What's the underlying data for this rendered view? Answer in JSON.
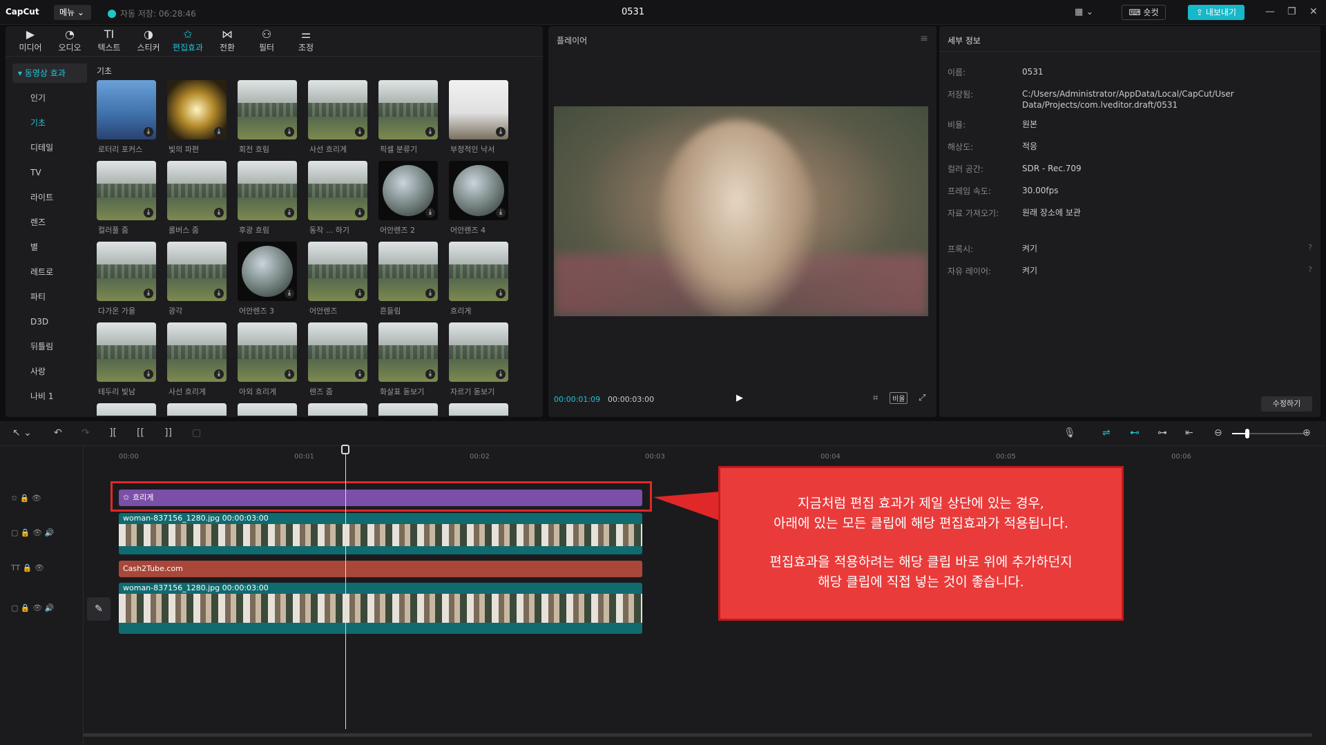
{
  "titlebar": {
    "logo": "CapCut",
    "menu_label": "메뉴 ⌄",
    "autosave": "자동 저장: 06:28:46",
    "doc_title": "0531",
    "layout_label": "▦ ⌄",
    "shortcut_label": "⌨ 숏컷",
    "export_label": "⇪ 내보내기",
    "win_min": "—",
    "win_max": "❐",
    "win_close": "✕"
  },
  "media": {
    "tabs": [
      {
        "icon": "▶",
        "label": "미디어"
      },
      {
        "icon": "◔",
        "label": "오디오"
      },
      {
        "icon": "TI",
        "label": "텍스트"
      },
      {
        "icon": "◑",
        "label": "스티커"
      },
      {
        "icon": "✩",
        "label": "편집효과"
      },
      {
        "icon": "⋈",
        "label": "전환"
      },
      {
        "icon": "⚇",
        "label": "필터"
      },
      {
        "icon": "⚌",
        "label": "조정"
      }
    ],
    "category_head": "▾ 동영상 효과",
    "categories": [
      "인기",
      "기초",
      "디테일",
      "TV",
      "라이트",
      "렌즈",
      "별",
      "레트로",
      "파티",
      "D3D",
      "뒤틀림",
      "사랑",
      "나비 1"
    ],
    "grid_label": "기초",
    "download_icon": "⤓",
    "effects": [
      "로터리 포커스",
      "빛의 파편",
      "회전 흐림",
      "사선 흐리게",
      "픽셀 분류기",
      "부정적인 낙서",
      "컬러풀 줌",
      "롤버스 줌",
      "후광 흐림",
      "동작 ... 하기",
      "어안렌즈 2",
      "어안렌즈 4",
      "다가온 가을",
      "광각",
      "어안렌즈 3",
      "어안렌즈",
      "흔들림",
      "흐리게",
      "테두리 빛남",
      "사선 흐리게",
      "아외 흐리게",
      "렌즈 줌",
      "화살표 돋보기",
      "자르기 돋보기"
    ]
  },
  "player": {
    "title": "플레이어",
    "menu_icon": "≡",
    "time_current": "00:00:01:09",
    "time_total": "00:00:03:00",
    "play_icon": "▶",
    "ratio_label": "비율",
    "screenshot_icon": "⌗",
    "fullscreen_icon": "⤢"
  },
  "details": {
    "title": "세부 정보",
    "rows": [
      {
        "k": "이름:",
        "v": "0531"
      },
      {
        "k": "저장됨:",
        "v": "C:/Users/Administrator/AppData/Local/CapCut/User Data/Projects/com.lveditor.draft/0531"
      },
      {
        "k": "비율:",
        "v": "원본"
      },
      {
        "k": "해상도:",
        "v": "적응"
      },
      {
        "k": "컬러 공간:",
        "v": "SDR - Rec.709"
      },
      {
        "k": "프레임 속도:",
        "v": "30.00fps"
      },
      {
        "k": "자료 가져오기:",
        "v": "원래 장소에 보관"
      },
      {
        "k": "프록시:",
        "v": "켜기"
      },
      {
        "k": "자유 레이어:",
        "v": "켜기"
      }
    ],
    "help_icon": "?",
    "modify_label": "수정하기"
  },
  "timeline": {
    "toolbar": {
      "select_icon": "↖ ⌄",
      "undo_icon": "↶",
      "redo_icon": "↷",
      "split_icon": "][",
      "split_left_icon": "[[",
      "split_right_icon": "]]",
      "delete_icon": "▢",
      "mic_icon": "🎙",
      "link1_icon": "⇌",
      "link2_icon": "⊷",
      "link3_icon": "⊶",
      "link4_icon": "⇤",
      "zoom_out_icon": "⊖",
      "zoom_in_icon": "⊕"
    },
    "zoom_level": 0.25,
    "ruler": [
      "00:00",
      "00:01",
      "00:02",
      "00:03",
      "00:04",
      "00:05",
      "00:06"
    ],
    "tracks": {
      "effect_icons": "✩  🔒  👁",
      "video_icons": "▢  🔒  👁  🔊",
      "text_icons": "TT  🔒  👁",
      "video2_icons": "▢  🔒  👁  🔊"
    },
    "clips": {
      "effect": "흐리게",
      "effect_icon": "✩",
      "video1": "woman-837156_1280.jpg   00:00:03:00",
      "text": "Cash2Tube.com",
      "video2": "woman-837156_1280.jpg   00:00:03:00"
    },
    "edit_icon": "✎"
  },
  "callout": {
    "line1": "지금처럼 편집 효과가 제일 상단에 있는 경우,",
    "line2": "아래에 있는 모든 클립에 해당 편집효과가 적용됩니다.",
    "line3": "편집효과을 적용하려는 해당 클립 바로 위에 추가하던지",
    "line4": "해당 클립에 직접 넣는 것이 좋습니다."
  }
}
